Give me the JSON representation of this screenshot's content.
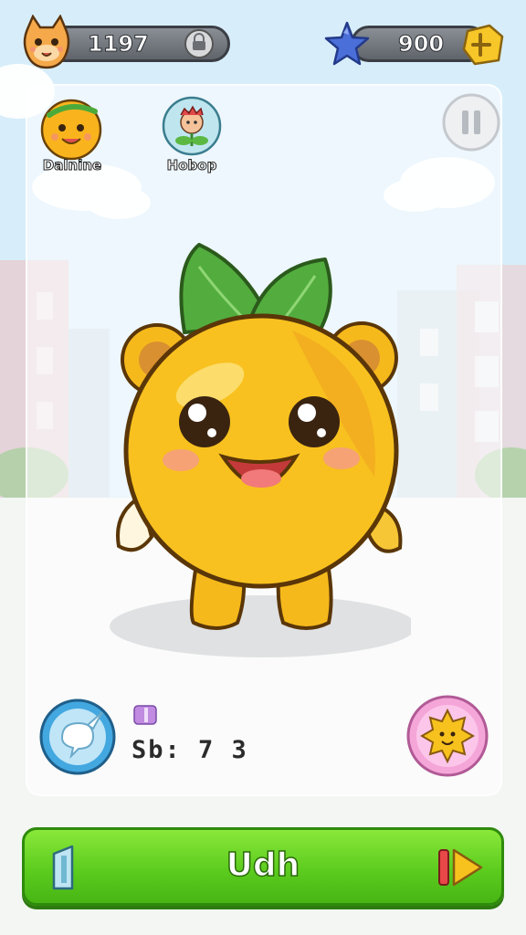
{
  "hud": {
    "coins_value": "1197",
    "stars_value": "900"
  },
  "players": [
    {
      "name": "Dalnine"
    },
    {
      "name": "Hobop"
    }
  ],
  "stat": {
    "text": "Sb: 7 3"
  },
  "action": {
    "label": "Udh"
  },
  "icons": {
    "coin_mascot": "cat-face-icon",
    "coin_badge": "lock-badge-icon",
    "star": "blue-star-icon",
    "plus_gem": "yellow-gem-icon",
    "pause": "pause-icon",
    "bubble": "speech-bubble-icon",
    "sun": "sun-face-icon",
    "left_card": "card-icon",
    "play": "play-arrow-icon"
  },
  "colors": {
    "action_green": "#5ccc1e",
    "character_yellow": "#f6b91c",
    "leaf_green": "#4caa3a"
  }
}
